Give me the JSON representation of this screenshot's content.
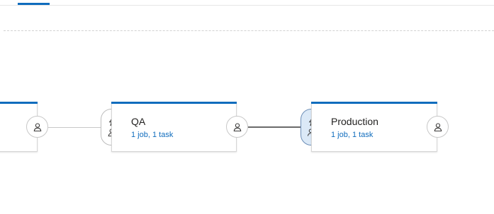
{
  "tabs": {
    "active_indicator_color": "#0f6cbd"
  },
  "stages": [
    {
      "id": "previous",
      "name": "",
      "summary": ""
    },
    {
      "id": "qa",
      "name": "QA",
      "summary": "1 job, 1 task",
      "pre_deployment": {
        "trigger_icon": "lightning-icon",
        "approver_icon": "person-icon",
        "active": false
      },
      "post_deployment": {
        "approver_icon": "person-icon"
      }
    },
    {
      "id": "production",
      "name": "Production",
      "summary": "1 job, 1 task",
      "pre_deployment": {
        "trigger_icon": "lightning-icon",
        "approver_icon": "person-check-icon",
        "active": true
      },
      "post_deployment": {
        "approver_icon": "person-icon"
      }
    }
  ],
  "colors": {
    "accent": "#0f6cbd",
    "link": "#0f6cbd",
    "active_pill_bg": "#dbe9f7"
  }
}
